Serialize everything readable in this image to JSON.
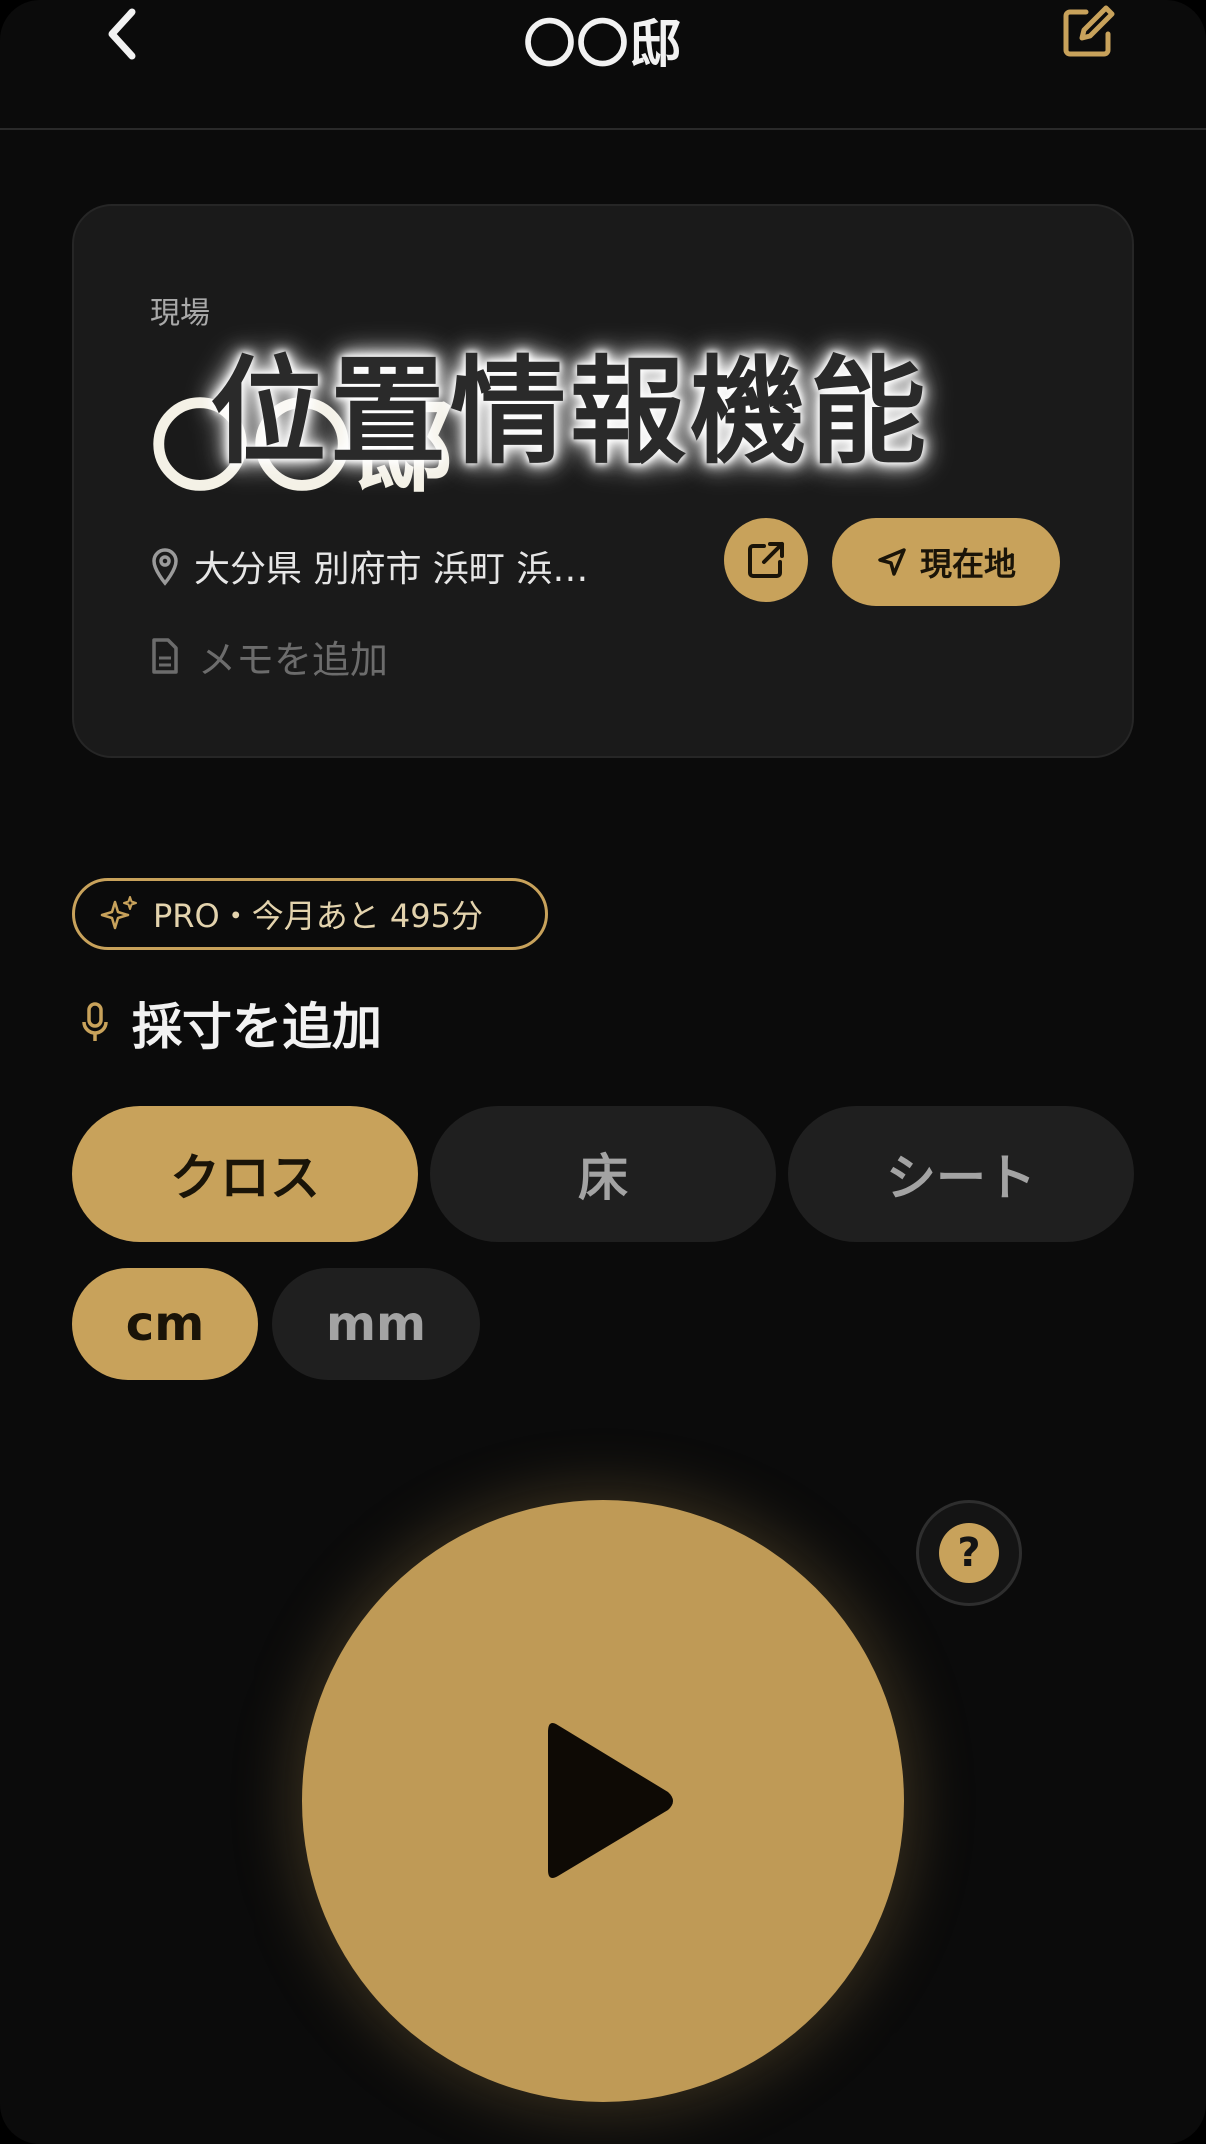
{
  "header": {
    "title": "〇〇邸"
  },
  "site_card": {
    "label": "現場",
    "name": "〇〇邸",
    "address": "大分県 別府市 浜町 浜…",
    "current_location_label": "現在地",
    "memo_placeholder": "メモを追加"
  },
  "overlay_caption": "位置情報機能",
  "pro_badge": {
    "text": "PRO・今月あと 495分"
  },
  "add_measure_label": "採寸を追加",
  "categories": [
    {
      "label": "クロス",
      "active": true
    },
    {
      "label": "床",
      "active": false
    },
    {
      "label": "シート",
      "active": false
    }
  ],
  "units": [
    {
      "label": "cm",
      "active": true
    },
    {
      "label": "mm",
      "active": false
    }
  ],
  "help_label": "?",
  "colors": {
    "accent": "#c8a25b",
    "background": "#0b0b0b",
    "card": "#1a1a1a"
  },
  "icons": [
    "back-icon",
    "edit-icon",
    "location-pin-icon",
    "external-link-icon",
    "navigation-arrow-icon",
    "document-icon",
    "sparkle-icon",
    "microphone-icon",
    "help-icon",
    "play-icon"
  ]
}
